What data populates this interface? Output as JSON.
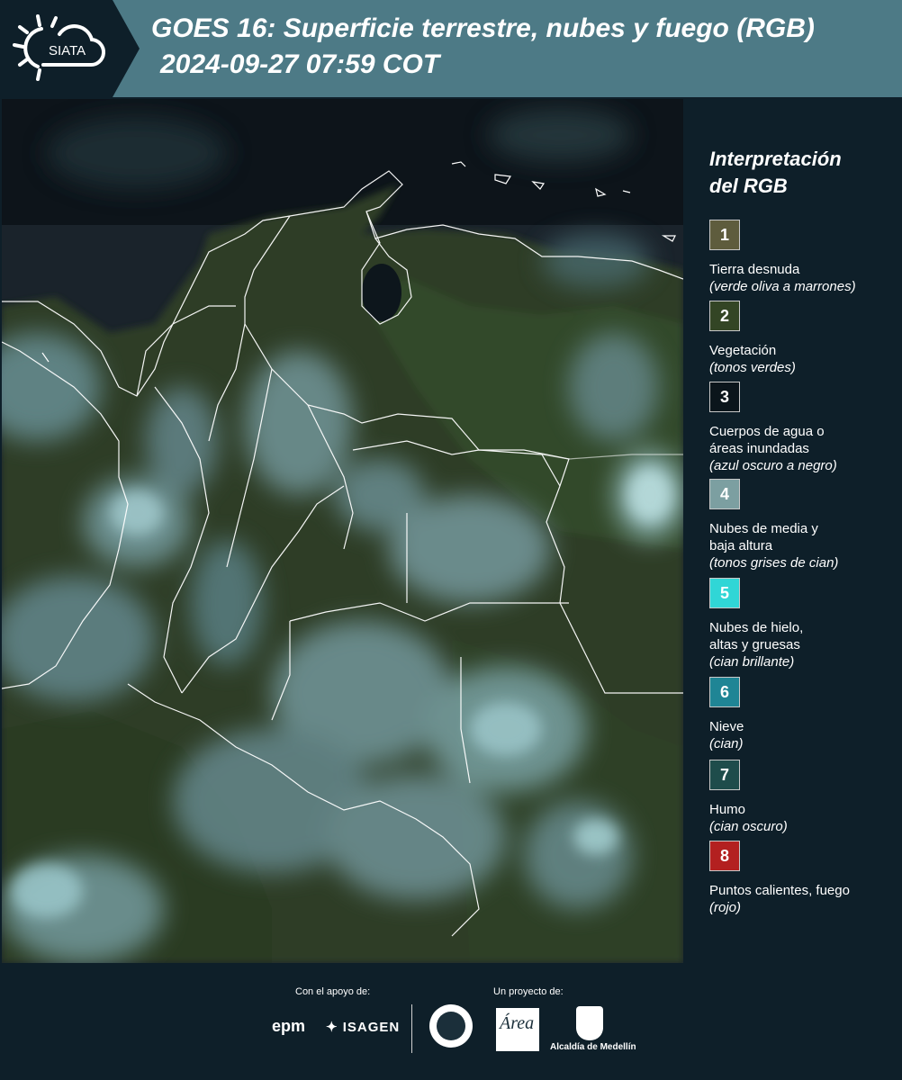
{
  "header": {
    "title": "GOES 16: Superficie terrestre, nubes y fuego (RGB)",
    "datetime": "2024-09-27 07:59 COT",
    "logo_text": "SIATA"
  },
  "legend": {
    "title_line1": "Interpretación",
    "title_line2": "del RGB",
    "items": [
      {
        "num": "1",
        "color": "#5e5c3d",
        "label": "Tierra desnuda",
        "desc": "(verde oliva a marrones)"
      },
      {
        "num": "2",
        "color": "#334525",
        "label": "Vegetación",
        "desc": "(tonos verdes)"
      },
      {
        "num": "3",
        "color": "#0b151b",
        "label": "Cuerpos de agua o áreas inundadas",
        "desc": "(azul oscuro a negro)"
      },
      {
        "num": "4",
        "color": "#7c9fa1",
        "label": "Nubes de media y baja altura",
        "desc": "(tonos grises de cian)"
      },
      {
        "num": "5",
        "color": "#30d6d6",
        "label": "Nubes de hielo, altas y gruesas",
        "desc": "(cian brillante)"
      },
      {
        "num": "6",
        "color": "#1f8595",
        "label": "Nieve",
        "desc": "(cian)"
      },
      {
        "num": "7",
        "color": "#1e4c4b",
        "label": "Humo",
        "desc": "(cian oscuro)"
      },
      {
        "num": "8",
        "color": "#b32020",
        "label": "Puntos calientes, fuego",
        "desc": "(rojo)"
      }
    ]
  },
  "footer": {
    "support_label": "Con el apoyo de:",
    "project_label": "Un proyecto de:",
    "sponsor1": "epm",
    "sponsor2": "ISAGEN",
    "area_text": "Área",
    "medellin_text": "Alcaldía de Medellín"
  }
}
